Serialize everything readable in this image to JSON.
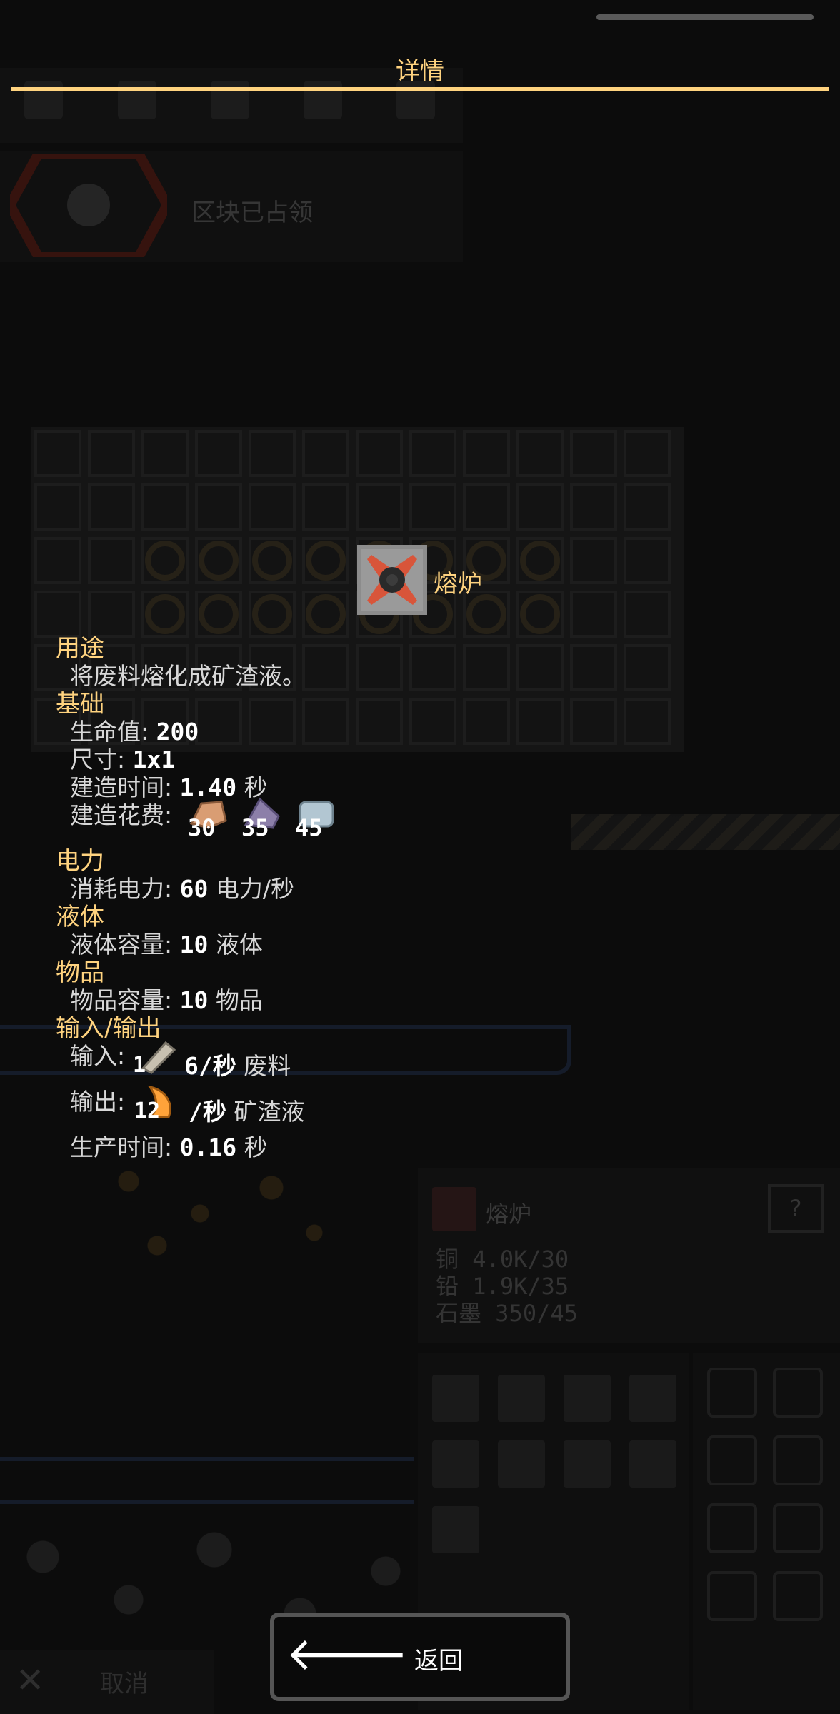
{
  "dialog": {
    "title": "详情",
    "back_label": "返回"
  },
  "block": {
    "name": "熔炉",
    "sections": {
      "purpose": "用途",
      "description": "将废料熔化成矿渣液。",
      "general": "基础",
      "power": "电力",
      "liquids": "液体",
      "items": "物品",
      "io": "输入/输出"
    },
    "stats": {
      "health_label": "生命值:",
      "health_value": "200",
      "size_label": "尺寸:",
      "size_value": "1x1",
      "build_time_label": "建造时间:",
      "build_time_value": "1.40",
      "build_time_unit": "秒",
      "build_cost_label": "建造花费:",
      "build_cost": [
        {
          "icon": "copper-icon",
          "amount": "30",
          "color": "#d99d73"
        },
        {
          "icon": "lead-icon",
          "amount": "35",
          "color": "#8c7fa9"
        },
        {
          "icon": "graphite-icon",
          "amount": "45",
          "color": "#b2c6d2"
        }
      ],
      "power_use_label": "消耗电力:",
      "power_use_value": "60",
      "power_use_unit": "电力/秒",
      "liquid_capacity_label": "液体容量:",
      "liquid_capacity_value": "10",
      "liquid_capacity_unit": "液体",
      "item_capacity_label": "物品容量:",
      "item_capacity_value": "10",
      "item_capacity_unit": "物品",
      "input_label": "输入:",
      "input_amount": "1",
      "input_rate": "6/秒",
      "input_item": "废料",
      "output_label": "输出:",
      "output_amount": "12",
      "output_rate": "/秒",
      "output_item": "矿渣液",
      "craft_time_label": "生产时间:",
      "craft_time_value": "0.16",
      "craft_time_unit": "秒"
    }
  },
  "background": {
    "sector_status": "区块已占领",
    "info_panel": {
      "title": "熔炉",
      "help": "?",
      "resources": [
        {
          "name": "铜",
          "value": "4.0K/30"
        },
        {
          "name": "铅",
          "value": "1.9K/35"
        },
        {
          "name": "石墨",
          "value": "350/45"
        }
      ]
    },
    "cancel_label": "取消"
  },
  "colors": {
    "accent": "#ffd37f",
    "background": "#0c0c0c"
  }
}
